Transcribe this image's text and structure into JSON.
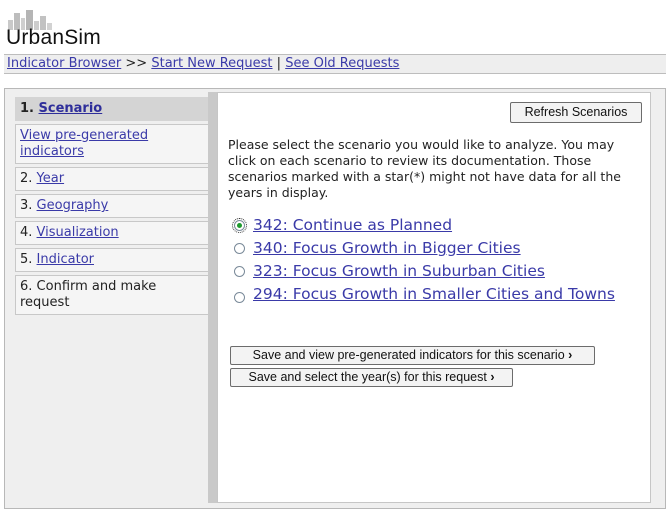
{
  "header": {
    "brand": "UrbanSim",
    "logo_icon": "city-skyline-icon"
  },
  "nav": {
    "indicator_browser": "Indicator Browser",
    "sep_arrows": ">>",
    "start_new_request": "Start New Request",
    "sep_bar": "|",
    "see_old_requests": "See Old Requests"
  },
  "steps": [
    {
      "num": "1.",
      "label": "Scenario",
      "active": true
    },
    {
      "num": "",
      "label": "View pre-generated indicators"
    },
    {
      "num": "2.",
      "label": "Year"
    },
    {
      "num": "3.",
      "label": "Geography"
    },
    {
      "num": "4.",
      "label": "Visualization"
    },
    {
      "num": "5.",
      "label": "Indicator"
    },
    {
      "num": "6.",
      "label": "Confirm and make request",
      "link": false
    }
  ],
  "main": {
    "refresh_label": "Refresh Scenarios",
    "intro": "Please select the scenario you would like to analyze. You may click on each scenario to review its documentation. Those scenarios marked with a star(*) might not have data for all the years in display.",
    "scenarios": [
      {
        "label": "342: Continue as Planned",
        "selected": true
      },
      {
        "label": "340: Focus Growth in Bigger Cities",
        "selected": false
      },
      {
        "label": "323: Focus Growth in Suburban Cities",
        "selected": false
      },
      {
        "label": "294: Focus Growth in Smaller Cities and Towns",
        "selected": false
      }
    ],
    "save_view_label": "Save and view pre-generated indicators for this scenario",
    "save_select_label": "Save and select the year(s) for this request",
    "chevron": "›"
  }
}
